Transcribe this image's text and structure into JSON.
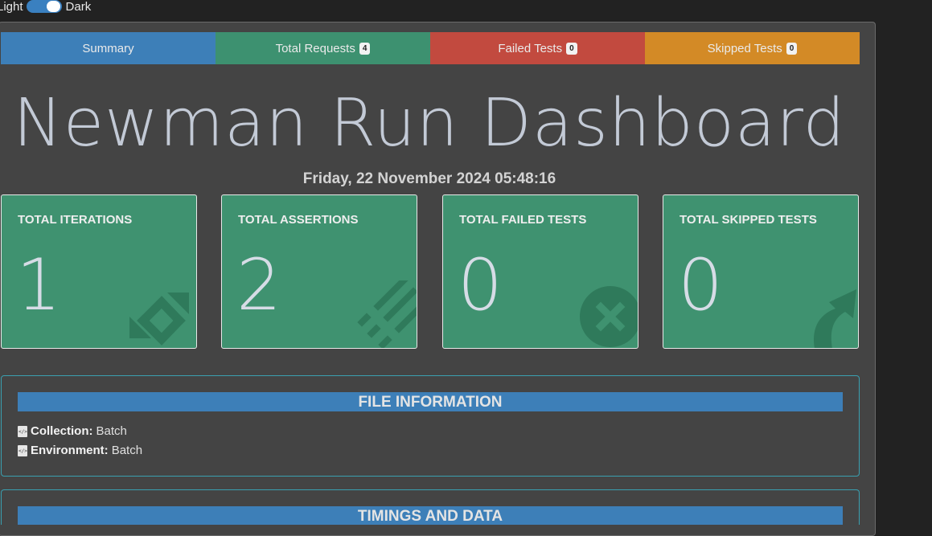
{
  "theme_toggle": {
    "light_label": "Light",
    "dark_label": "Dark",
    "state": "dark"
  },
  "tabs": [
    {
      "label": "Summary",
      "count": null,
      "color": "#3d7fb8"
    },
    {
      "label": "Total Requests",
      "count": "4",
      "color": "#3d9170"
    },
    {
      "label": "Failed Tests",
      "count": "0",
      "color": "#c24a3f"
    },
    {
      "label": "Skipped Tests",
      "count": "0",
      "color": "#d38a26"
    }
  ],
  "title": "Newman Run Dashboard",
  "run_date": "Friday, 22 November 2024 05:48:16",
  "cards": [
    {
      "title": "TOTAL ITERATIONS",
      "value": "1",
      "icon": "sync-icon"
    },
    {
      "title": "TOTAL ASSERTIONS",
      "value": "2",
      "icon": "list-icon"
    },
    {
      "title": "TOTAL FAILED TESTS",
      "value": "0",
      "icon": "times-circle-icon"
    },
    {
      "title": "TOTAL SKIPPED TESTS",
      "value": "0",
      "icon": "share-arrow-icon"
    }
  ],
  "file_information": {
    "heading": "FILE INFORMATION",
    "collection_label": "Collection:",
    "collection_value": "Batch",
    "environment_label": "Environment:",
    "environment_value": "Batch"
  },
  "timings": {
    "heading": "TIMINGS AND DATA"
  }
}
